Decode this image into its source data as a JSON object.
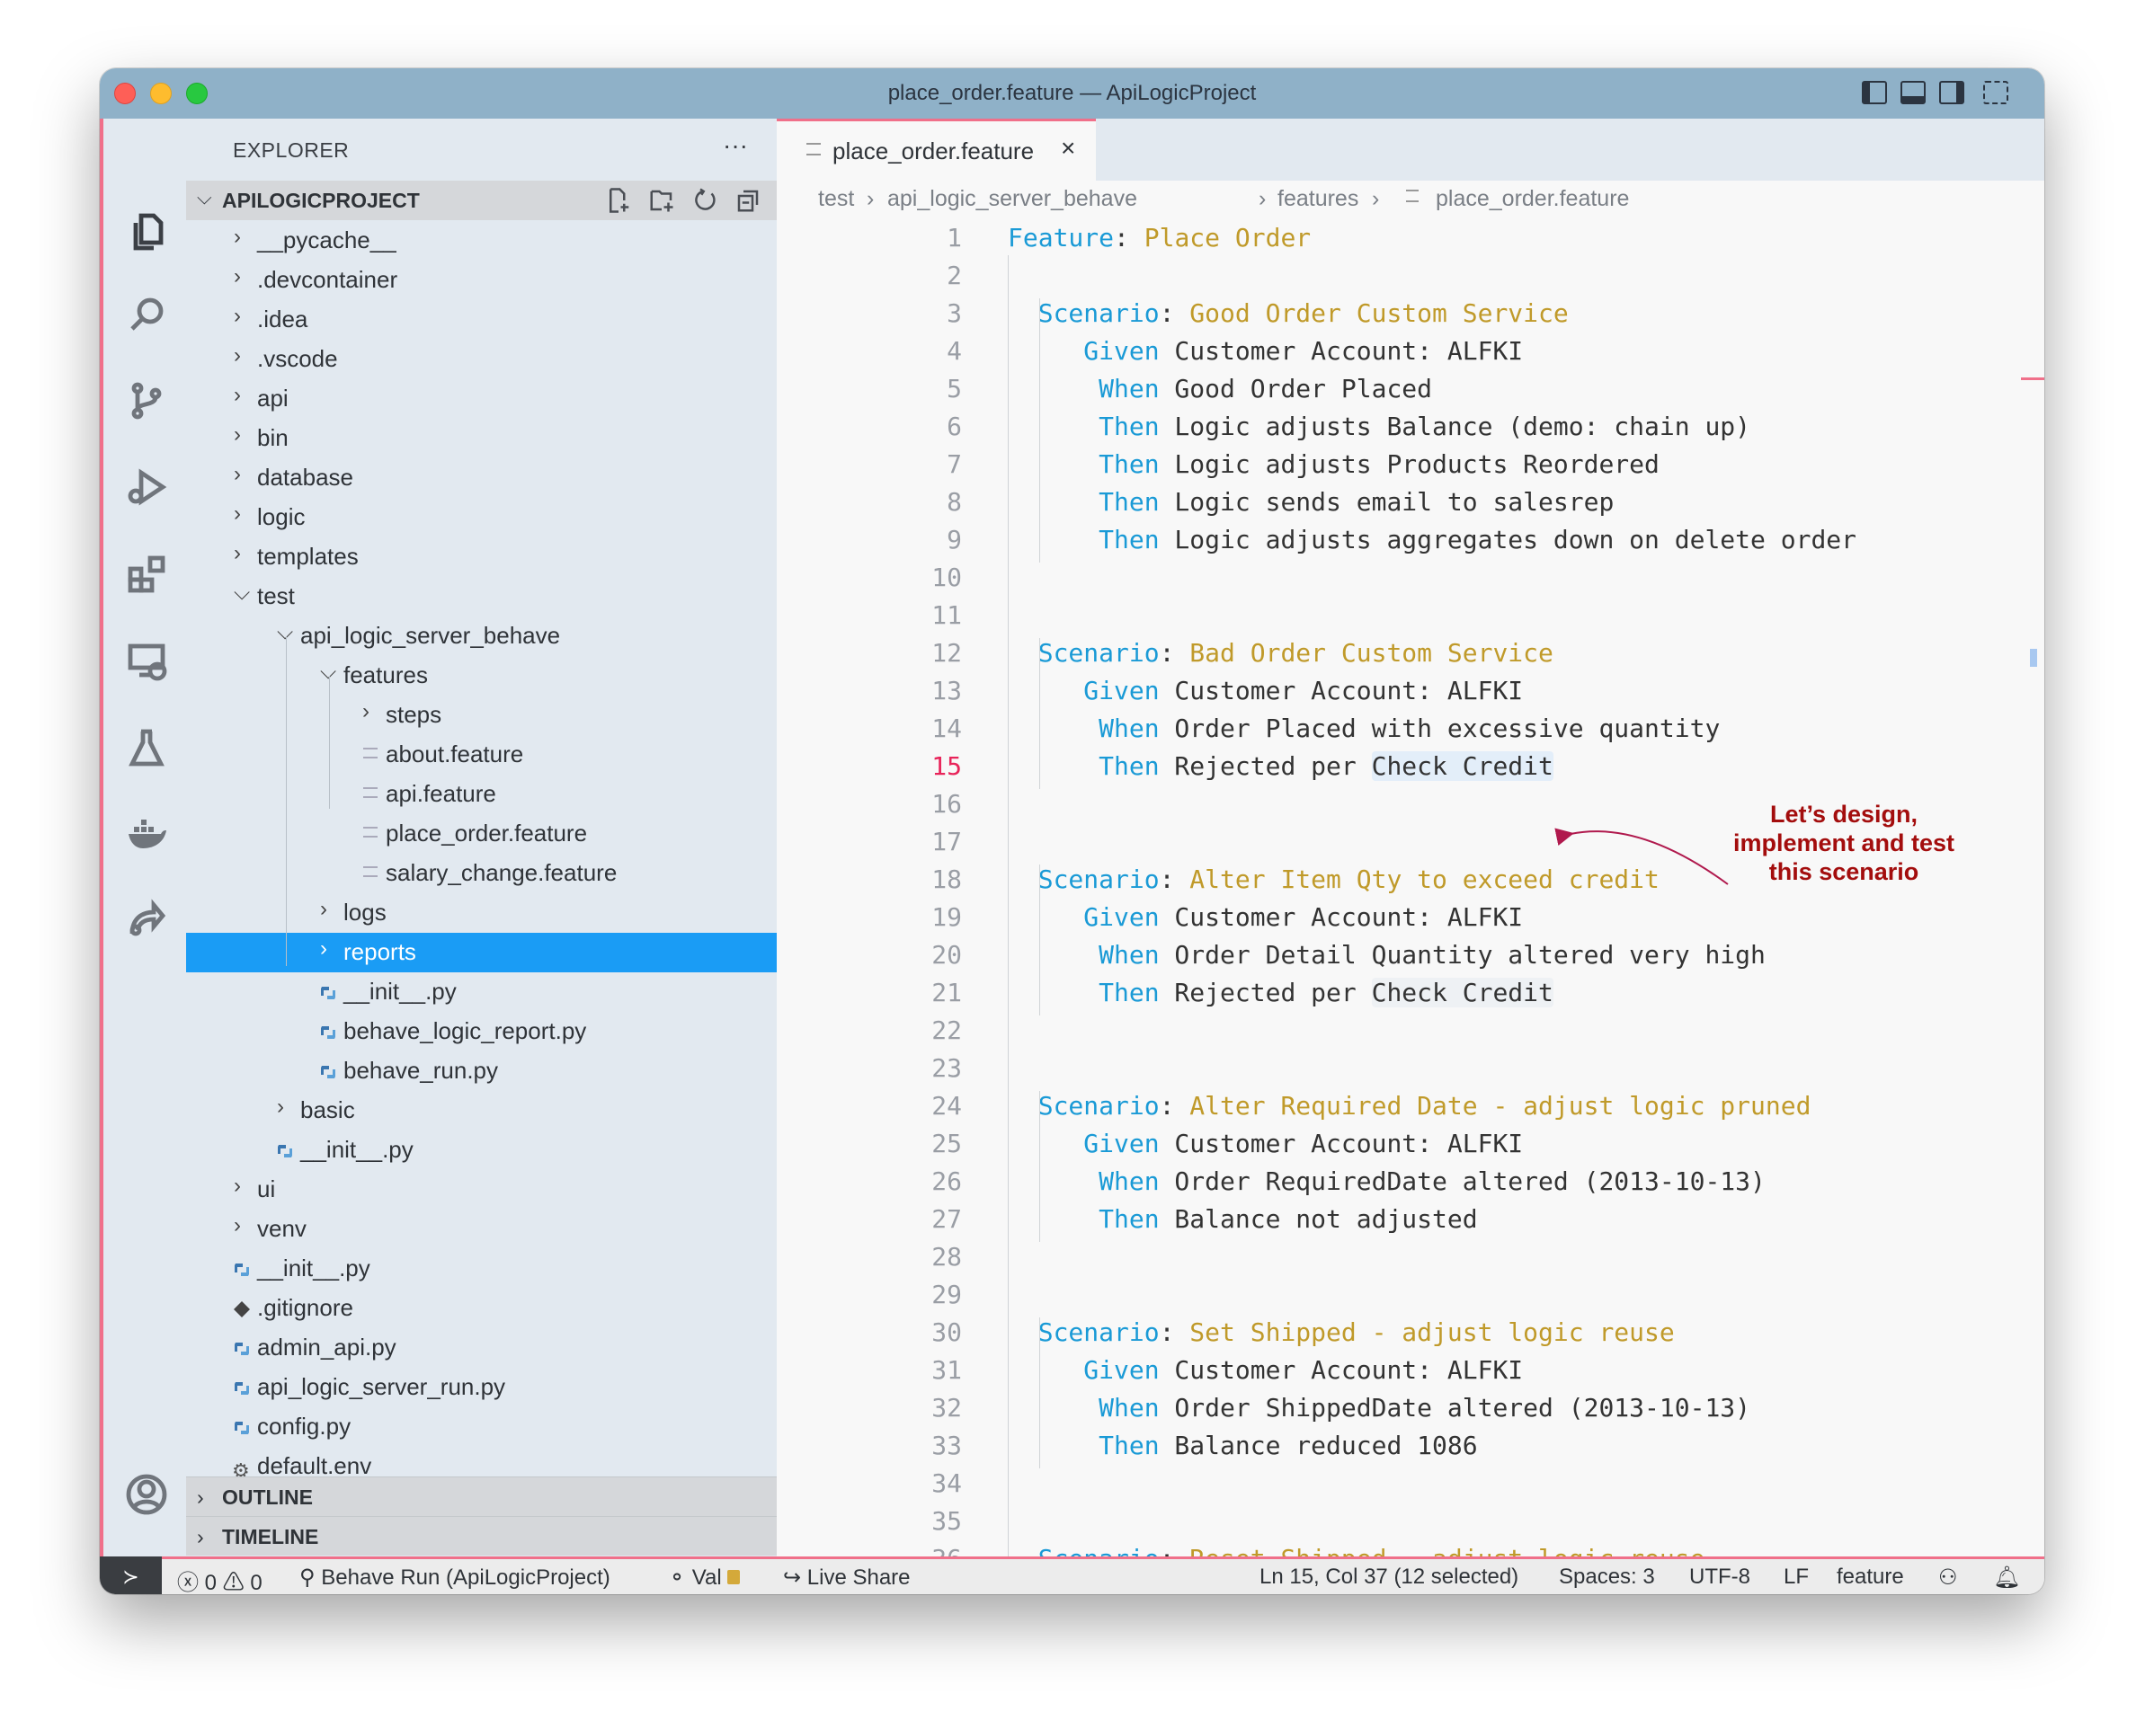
{
  "window": {
    "title": "place_order.feature — ApiLogicProject"
  },
  "colors": {
    "titlebar": "#8fb1c8",
    "accent": "#f0708a",
    "selection": "#1a9cf5",
    "keyword": "#1a9ad6",
    "title": "#c09a2a",
    "annotation": "#a30d0d"
  },
  "activity_bar": {
    "icons": [
      "explorer-icon",
      "search-icon",
      "source-control-icon",
      "run-debug-icon",
      "extensions-icon",
      "remote-explorer-icon",
      "testing-icon",
      "docker-icon",
      "live-share-icon",
      "account-icon",
      "settings-gear-icon"
    ]
  },
  "sidebar": {
    "title": "EXPLORER",
    "more": "···",
    "project": "APILOGICPROJECT",
    "tree": [
      {
        "label": "__pycache__",
        "level": 1,
        "kind": "folder"
      },
      {
        "label": ".devcontainer",
        "level": 1,
        "kind": "folder"
      },
      {
        "label": ".idea",
        "level": 1,
        "kind": "folder"
      },
      {
        "label": ".vscode",
        "level": 1,
        "kind": "folder"
      },
      {
        "label": "api",
        "level": 1,
        "kind": "folder"
      },
      {
        "label": "bin",
        "level": 1,
        "kind": "folder"
      },
      {
        "label": "database",
        "level": 1,
        "kind": "folder"
      },
      {
        "label": "logic",
        "level": 1,
        "kind": "folder"
      },
      {
        "label": "templates",
        "level": 1,
        "kind": "folder"
      },
      {
        "label": "test",
        "level": 1,
        "kind": "folder-open"
      },
      {
        "label": "api_logic_server_behave",
        "level": 2,
        "kind": "folder-open"
      },
      {
        "label": "features",
        "level": 3,
        "kind": "folder-open"
      },
      {
        "label": "steps",
        "level": 4,
        "kind": "folder"
      },
      {
        "label": "about.feature",
        "level": 4,
        "kind": "feature"
      },
      {
        "label": "api.feature",
        "level": 4,
        "kind": "feature"
      },
      {
        "label": "place_order.feature",
        "level": 4,
        "kind": "feature"
      },
      {
        "label": "salary_change.feature",
        "level": 4,
        "kind": "feature"
      },
      {
        "label": "logs",
        "level": 3,
        "kind": "folder"
      },
      {
        "label": "reports",
        "level": 3,
        "kind": "folder",
        "selected": true
      },
      {
        "label": "__init__.py",
        "level": 3,
        "kind": "python"
      },
      {
        "label": "behave_logic_report.py",
        "level": 3,
        "kind": "python"
      },
      {
        "label": "behave_run.py",
        "level": 3,
        "kind": "python"
      },
      {
        "label": "basic",
        "level": 2,
        "kind": "folder"
      },
      {
        "label": "__init__.py",
        "level": 2,
        "kind": "python"
      },
      {
        "label": "ui",
        "level": 1,
        "kind": "folder"
      },
      {
        "label": "venv",
        "level": 1,
        "kind": "folder"
      },
      {
        "label": "__init__.py",
        "level": 1,
        "kind": "python"
      },
      {
        "label": ".gitignore",
        "level": 1,
        "kind": "git"
      },
      {
        "label": "admin_api.py",
        "level": 1,
        "kind": "python"
      },
      {
        "label": "api_logic_server_run.py",
        "level": 1,
        "kind": "python"
      },
      {
        "label": "config.py",
        "level": 1,
        "kind": "python"
      },
      {
        "label": "default.env",
        "level": 1,
        "kind": "gear"
      }
    ],
    "outline": "OUTLINE",
    "timeline": "TIMELINE"
  },
  "editor": {
    "tab": {
      "label": "place_order.feature",
      "close": "×"
    },
    "breadcrumbs": [
      "test",
      "api_logic_server_behave",
      "features",
      "place_order.feature"
    ],
    "current_line": 15,
    "lines": [
      {
        "kw": "Feature",
        "sep": ": ",
        "rest": "Place Order",
        "t": "title"
      },
      {},
      {
        "kw": "  Scenario",
        "sep": ": ",
        "rest": "Good Order Custom Service",
        "t": "title"
      },
      {
        "kw": "     Given",
        "rest": " Customer Account: ALFKI"
      },
      {
        "kw": "      When",
        "rest": " Good Order Placed"
      },
      {
        "kw": "      Then",
        "rest": " Logic adjusts Balance (demo: chain up)"
      },
      {
        "kw": "      Then",
        "rest": " Logic adjusts Products Reordered"
      },
      {
        "kw": "      Then",
        "rest": " Logic sends email to salesrep"
      },
      {
        "kw": "      Then",
        "rest": " Logic adjusts aggregates down on delete order"
      },
      {},
      {},
      {
        "kw": "  Scenario",
        "sep": ": ",
        "rest": "Bad Order Custom Service",
        "t": "title"
      },
      {
        "kw": "     Given",
        "rest": " Customer Account: ALFKI"
      },
      {
        "kw": "      When",
        "rest": " Order Placed with excessive quantity"
      },
      {
        "kw": "      Then",
        "rest": " Rejected per ",
        "hl": "Check Credit",
        "hlt": "sel"
      },
      {},
      {},
      {
        "kw": "  Scenario",
        "sep": ": ",
        "rest": "Alter Item Qty to exceed credit",
        "t": "title"
      },
      {
        "kw": "     Given",
        "rest": " Customer Account: ALFKI"
      },
      {
        "kw": "      When",
        "rest": " Order Detail Quantity altered very high"
      },
      {
        "kw": "      Then",
        "rest": " Rejected per ",
        "hl": "Check Credit",
        "hlt": "occ"
      },
      {},
      {},
      {
        "kw": "  Scenario",
        "sep": ": ",
        "rest": "Alter Required Date - adjust logic pruned",
        "t": "title"
      },
      {
        "kw": "     Given",
        "rest": " Customer Account: ALFKI"
      },
      {
        "kw": "      When",
        "rest": " Order RequiredDate altered (2013-10-13)"
      },
      {
        "kw": "      Then",
        "rest": " Balance not adjusted"
      },
      {},
      {},
      {
        "kw": "  Scenario",
        "sep": ": ",
        "rest": "Set Shipped - adjust logic reuse",
        "t": "title"
      },
      {
        "kw": "     Given",
        "rest": " Customer Account: ALFKI"
      },
      {
        "kw": "      When",
        "rest": " Order ShippedDate altered (2013-10-13)"
      },
      {
        "kw": "      Then",
        "rest": " Balance reduced 1086"
      },
      {},
      {},
      {
        "kw": "  Scenario",
        "sep": ": ",
        "rest": "Reset Shipped - adjust logic reuse",
        "t": "title"
      }
    ],
    "annotation": [
      "Let’s design,",
      "implement and test",
      "this scenario"
    ]
  },
  "status_bar": {
    "problems_errors": "0",
    "problems_warnings": "0",
    "run": "Behave Run (ApiLogicProject)",
    "val": "Val",
    "live_share": "Live Share",
    "position": "Ln 15, Col 37 (12 selected)",
    "spaces": "Spaces: 3",
    "encoding": "UTF-8",
    "eol": "LF",
    "language": "feature"
  }
}
